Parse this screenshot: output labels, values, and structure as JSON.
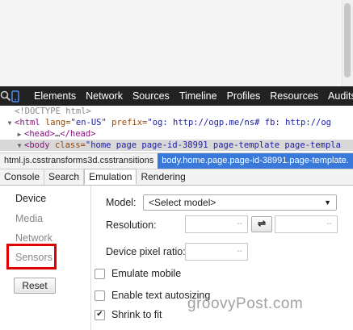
{
  "toolbar": {
    "tabs": [
      "Elements",
      "Network",
      "Sources",
      "Timeline",
      "Profiles",
      "Resources",
      "Audits"
    ]
  },
  "elements_panel": {
    "doctype": "<!DOCTYPE html>",
    "html_open": "<html",
    "html_attr1": "lang=",
    "html_val1": "\"en-US\"",
    "html_attr2": "prefix=",
    "html_val2": "\"og: http://ogp.me/ns# fb: http://og",
    "head_open": "<head>",
    "head_ellipsis": "…",
    "head_close": "</head>",
    "body_open": "<body",
    "body_attr": "class=",
    "body_val": "\"home page page-id-38991 page-template page-templa"
  },
  "breadcrumbs": {
    "items": [
      "html.js.csstransforms3d.csstransitions",
      "body.home.page.page-id-38991.page-template."
    ]
  },
  "drawer": {
    "tabs": [
      "Console",
      "Search",
      "Emulation",
      "Rendering"
    ]
  },
  "emulation": {
    "sidebar": [
      "Device",
      "Media",
      "Network",
      "Sensors"
    ],
    "reset_label": "Reset",
    "model_label": "Model:",
    "model_value": "<Select model>",
    "resolution_label": "Resolution:",
    "swap_label": "⇌",
    "dpr_label": "Device pixel ratio:",
    "input_placeholder": "--",
    "checkboxes": [
      {
        "label": "Emulate mobile",
        "checked": false
      },
      {
        "label": "Enable text autosizing",
        "checked": false
      },
      {
        "label": "Shrink to fit",
        "checked": true
      }
    ]
  },
  "watermark": "groovyPost.com"
}
